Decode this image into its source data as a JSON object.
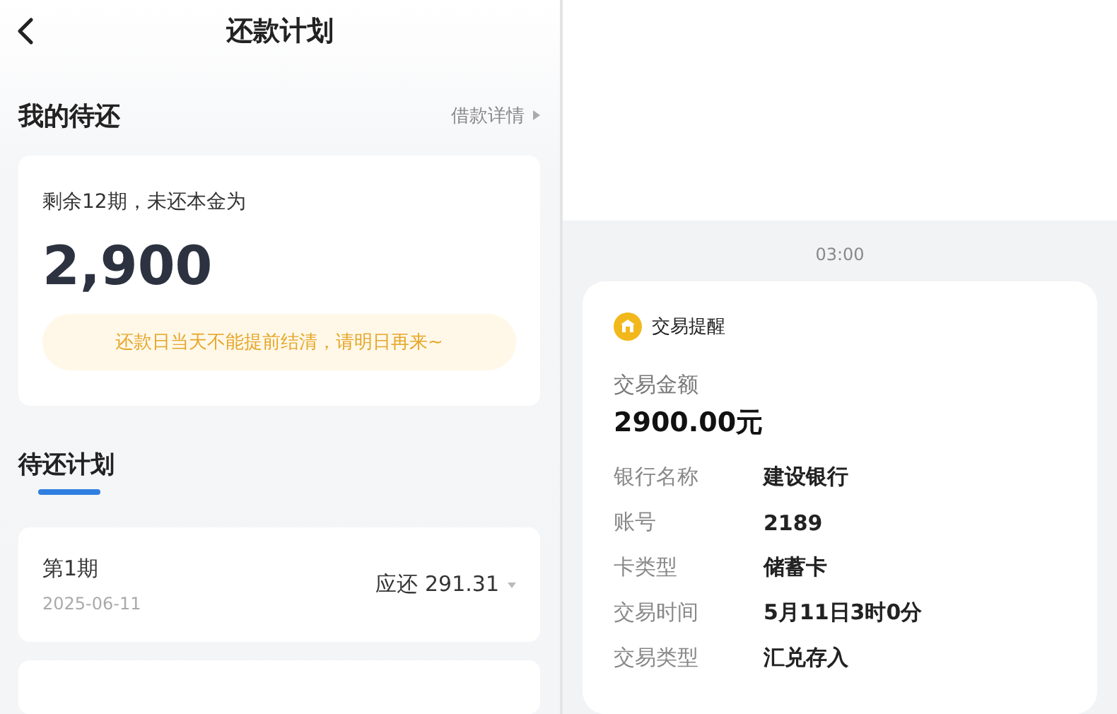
{
  "left": {
    "title": "还款计划",
    "summary": {
      "heading": "我的待还",
      "link": "借款详情",
      "remaining": "剩余12期，未还本金为",
      "amount": "2,900",
      "notice": "还款日当天不能提前结清，请明日再来~"
    },
    "plan": {
      "tab": "待还计划",
      "selected": true,
      "items": [
        {
          "period": "第1期",
          "date": "2025-06-11",
          "due": "应还 291.31"
        }
      ]
    }
  },
  "right": {
    "time": "03:00",
    "message": {
      "title": "交易提醒",
      "amount_label": "交易金额",
      "amount": "2900.00元",
      "fields": [
        {
          "label": "银行名称",
          "value": "建设银行"
        },
        {
          "label": "账号",
          "value": "2189"
        },
        {
          "label": "卡类型",
          "value": "储蓄卡"
        },
        {
          "label": "交易时间",
          "value": "5月11日3时0分"
        },
        {
          "label": "交易类型",
          "value": "汇兑存入"
        }
      ]
    }
  }
}
